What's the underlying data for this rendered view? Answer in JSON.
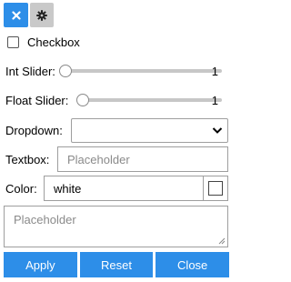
{
  "toolbar": {
    "close_icon": "close-icon",
    "settings_icon": "gear-icon"
  },
  "checkbox": {
    "label": "Checkbox",
    "checked": false
  },
  "int_slider": {
    "label": "Int Slider:",
    "value": "1",
    "min_fraction": 0
  },
  "float_slider": {
    "label": "Float Slider:",
    "value": "1",
    "min_fraction": 0
  },
  "dropdown": {
    "label": "Dropdown:",
    "selected": ""
  },
  "textbox": {
    "label": "Textbox:",
    "placeholder": "Placeholder",
    "value": ""
  },
  "color": {
    "label": "Color:",
    "value": "white",
    "swatch": "#ffffff"
  },
  "textarea": {
    "placeholder": "Placeholder",
    "value": ""
  },
  "buttons": {
    "apply": "Apply",
    "reset": "Reset",
    "close": "Close"
  },
  "colors": {
    "accent": "#2d8ee8",
    "toolbar_inactive": "#c9c9c9",
    "border": "#9e9e9e"
  }
}
